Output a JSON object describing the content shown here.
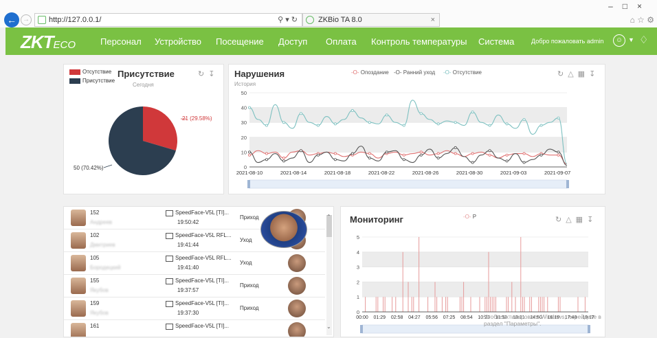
{
  "browser": {
    "url": "http://127.0.0.1/",
    "search_reload": "⚲ ▾ ↻",
    "tab_title": "ZKBio TA 8.0",
    "close": "×"
  },
  "nav": {
    "logo": "ZKT",
    "logo_small": "ECO",
    "items": [
      "Персонал",
      "Устройство",
      "Посещение",
      "Доступ",
      "Оплата",
      "Контроль температуры",
      "Система"
    ],
    "welcome": "Добро пожаловать admin"
  },
  "attendance": {
    "title": "Присутствие",
    "subtitle": "Сегодня",
    "legend": [
      {
        "label": "Отсутствие",
        "color": "#d0383a"
      },
      {
        "label": "Присутствие",
        "color": "#2c3e50"
      }
    ],
    "label_absent": "21 (29.58%)",
    "label_present": "50 (70.42%)"
  },
  "violations": {
    "title": "Нарушения",
    "subtitle": "История",
    "legend": [
      "Опоздание",
      "Ранний уход",
      "Отсутствие"
    ]
  },
  "monitoring": {
    "title": "Мониторинг",
    "legend": "P"
  },
  "records": [
    {
      "pin": "152",
      "name": "Андреев",
      "device": "SpeedFace-V5L [TI]...",
      "time": "19:50:42",
      "status": "Приход"
    },
    {
      "pin": "102",
      "name": "Дмитриев",
      "device": "SpeedFace-V5L RFL...",
      "time": "19:41:44",
      "status": "Уход"
    },
    {
      "pin": "105",
      "name": "Бородецкий",
      "device": "SpeedFace-V5L RFL...",
      "time": "19:41:40",
      "status": "Уход"
    },
    {
      "pin": "155",
      "name": "Якубов",
      "device": "SpeedFace-V5L [TI]...",
      "time": "19:37:57",
      "status": "Приход"
    },
    {
      "pin": "159",
      "name": "Якубов",
      "device": "SpeedFace-V5L [TI]...",
      "time": "19:37:30",
      "status": "Приход"
    },
    {
      "pin": "161",
      "name": "",
      "device": "SpeedFace-V5L [TI]...",
      "time": "",
      "status": ""
    }
  ],
  "watermark": "Чтобы активировать Windows, перейдите в раздел \"Параметры\".",
  "chart_data": [
    {
      "type": "pie",
      "title": "Присутствие",
      "categories": [
        "Отсутствие",
        "Присутствие"
      ],
      "values": [
        21,
        50
      ],
      "colors": [
        "#d0383a",
        "#2c3e50"
      ]
    },
    {
      "type": "line",
      "title": "Нарушения",
      "x_ticks": [
        "2021-08-10",
        "2021-08-14",
        "2021-08-18",
        "2021-08-22",
        "2021-08-26",
        "2021-08-30",
        "2021-09-03",
        "2021-09-07"
      ],
      "ylim": [
        0,
        50
      ],
      "y_ticks": [
        0,
        10,
        20,
        30,
        40,
        50
      ],
      "series": [
        {
          "name": "Опоздание",
          "color": "#e07070",
          "values": [
            8,
            11,
            9,
            10,
            6,
            10,
            11,
            8,
            9,
            10,
            9,
            7,
            8,
            10,
            9,
            6,
            9,
            10,
            8,
            9,
            10,
            8,
            9,
            11,
            9,
            7,
            9,
            10,
            8,
            6,
            8,
            9,
            9,
            7,
            9,
            8,
            8,
            2
          ]
        },
        {
          "name": "Ранний уход",
          "color": "#555555",
          "values": [
            10,
            3,
            5,
            9,
            4,
            6,
            11,
            3,
            8,
            10,
            5,
            4,
            9,
            14,
            6,
            4,
            10,
            11,
            5,
            3,
            8,
            12,
            6,
            9,
            13,
            7,
            3,
            8,
            11,
            6,
            4,
            9,
            3,
            5,
            8,
            12,
            10,
            1
          ]
        },
        {
          "name": "Отсутствие",
          "color": "#7cc0c0",
          "values": [
            40,
            32,
            28,
            42,
            30,
            26,
            36,
            30,
            28,
            34,
            29,
            32,
            38,
            33,
            30,
            29,
            35,
            30,
            28,
            45,
            36,
            32,
            29,
            31,
            30,
            28,
            37,
            30,
            28,
            35,
            29,
            26,
            32,
            22,
            28,
            30,
            33,
            2
          ]
        }
      ]
    },
    {
      "type": "bar",
      "title": "Мониторинг",
      "x_ticks": [
        "00:00",
        "01:29",
        "02:58",
        "04:27",
        "05:56",
        "07:25",
        "08:54",
        "10:23",
        "11:52",
        "13:21",
        "14:50",
        "16:19",
        "17:48",
        "19:17"
      ],
      "ylim": [
        0,
        5
      ],
      "y_ticks": [
        0,
        1,
        2,
        3,
        4,
        5
      ],
      "series": [
        {
          "name": "P",
          "color": "#e69a9a"
        }
      ]
    }
  ]
}
